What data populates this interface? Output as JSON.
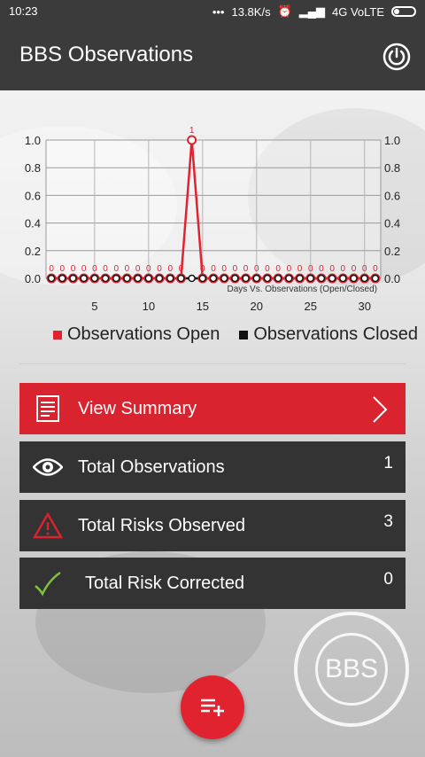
{
  "status_bar": {
    "time": "10:23",
    "net_speed": "13.8K/s",
    "network": "4G VoLTE"
  },
  "app_bar": {
    "title": "BBS Observations"
  },
  "chart_data": {
    "type": "line",
    "x": [
      1,
      2,
      3,
      4,
      5,
      6,
      7,
      8,
      9,
      10,
      11,
      12,
      13,
      14,
      15,
      16,
      17,
      18,
      19,
      20,
      21,
      22,
      23,
      24,
      25,
      26,
      27,
      28,
      29,
      30,
      31
    ],
    "series": [
      {
        "name": "Observations Open",
        "color": "#e0232e",
        "values": [
          0,
          0,
          0,
          0,
          0,
          0,
          0,
          0,
          0,
          0,
          0,
          0,
          0,
          1,
          0,
          0,
          0,
          0,
          0,
          0,
          0,
          0,
          0,
          0,
          0,
          0,
          0,
          0,
          0,
          0,
          0
        ]
      },
      {
        "name": "Observations Closed",
        "color": "#111111",
        "values": [
          0,
          0,
          0,
          0,
          0,
          0,
          0,
          0,
          0,
          0,
          0,
          0,
          0,
          0,
          0,
          0,
          0,
          0,
          0,
          0,
          0,
          0,
          0,
          0,
          0,
          0,
          0,
          0,
          0,
          0,
          0
        ]
      }
    ],
    "xlabel": "Days Vs. Observations (Open/Closed)",
    "ylim": [
      0,
      1.0
    ],
    "y_ticks": [
      "0.0",
      "0.2",
      "0.4",
      "0.6",
      "0.8",
      "1.0"
    ],
    "x_ticks": [
      "5",
      "10",
      "15",
      "20",
      "25",
      "30"
    ],
    "x_tick_values": [
      5,
      10,
      15,
      20,
      25,
      30
    ]
  },
  "legend": {
    "open": "Observations Open",
    "closed": "Observations Closed"
  },
  "cards": {
    "summary_label": "View Summary",
    "total_obs_label": "Total Observations",
    "total_obs_value": "1",
    "total_risks_label": "Total Risks Observed",
    "total_risks_value": "3",
    "risk_corrected_label": "Total Risk Corrected",
    "risk_corrected_value": "0"
  },
  "seal": {
    "text": "BBS"
  }
}
